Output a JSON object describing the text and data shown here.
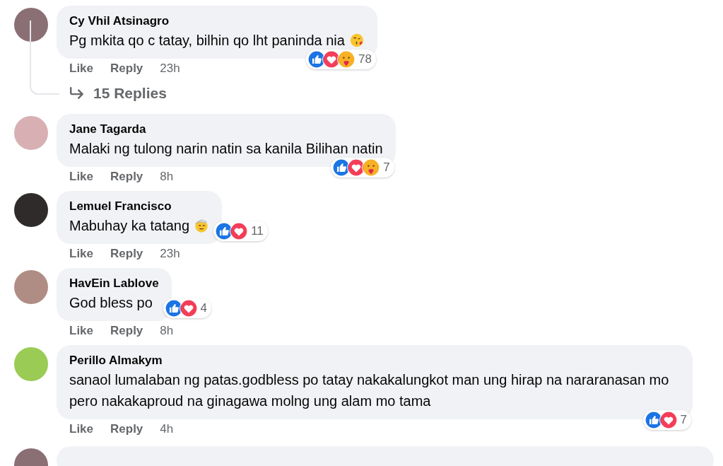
{
  "comments": [
    {
      "author": "Cy Vhil Atsinagro",
      "text": "Pg mkita qo c tatay, bilhin qo lht paninda nia",
      "emoji": {
        "kind": "kiss"
      },
      "reactions": [
        {
          "kind": "like"
        },
        {
          "kind": "love"
        },
        {
          "kind": "care"
        }
      ],
      "reaction_count": "78",
      "actions": [
        "Like",
        "Reply"
      ],
      "time": "23h",
      "replies": "15 Replies"
    },
    {
      "author": "Jane Tagarda",
      "text": "Malaki ng tulong narin natin sa kanila Bilihan natin",
      "reactions": [
        {
          "kind": "like"
        },
        {
          "kind": "love"
        },
        {
          "kind": "care"
        }
      ],
      "reaction_count": "7",
      "actions": [
        "Like",
        "Reply"
      ],
      "time": "8h"
    },
    {
      "author": "Lemuel Francisco",
      "text": "Mabuhay ka tatang",
      "emoji": {
        "kind": "salute"
      },
      "reactions": [
        {
          "kind": "like"
        },
        {
          "kind": "love"
        }
      ],
      "reaction_count": "11",
      "actions": [
        "Like",
        "Reply"
      ],
      "time": "23h"
    },
    {
      "author": "HavEin Lablove",
      "text": "God bless po",
      "reactions": [
        {
          "kind": "like"
        },
        {
          "kind": "love"
        }
      ],
      "reaction_count": "4",
      "actions": [
        "Like",
        "Reply"
      ],
      "time": "8h"
    },
    {
      "author": "Perillo Almakym",
      "text": "sanaol lumalaban ng patas.godbless po tatay nakakalungkot man ung hirap na nararanasan mo pero nakakaproud na ginagawa molng ung alam mo tama",
      "reactions": [
        {
          "kind": "like"
        },
        {
          "kind": "love"
        }
      ],
      "reaction_count": "7",
      "actions": [
        "Like",
        "Reply"
      ],
      "time": "4h"
    }
  ]
}
